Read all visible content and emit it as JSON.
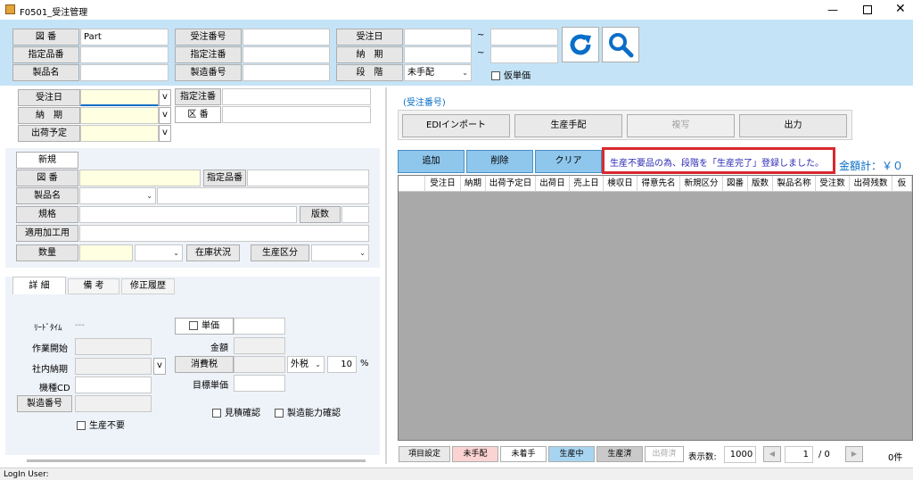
{
  "window": {
    "title": "F0501_受注管理"
  },
  "search": {
    "zuban_label": "図 番",
    "zuban_value": "Part",
    "shitei_hinban_label": "指定品番",
    "seihinmei_label": "製品名",
    "juchu_bango_label": "受注番号",
    "shitei_chuban_label": "指定注番",
    "seizo_bango_label": "製造番号",
    "juchubi_label": "受注日",
    "noki_label": "納　期",
    "dankai_label": "段　階",
    "dankai_value": "未手配",
    "tilde": "~",
    "karitanka_label": "仮単価"
  },
  "left": {
    "juchubi_label": "受注日",
    "noki_label": "納　期",
    "shukka_yotei_label": "出荷予定",
    "shitei_chuban_label": "指定注番",
    "kuban_label": "区 番",
    "v": "v",
    "shinki_label": "新規",
    "zuban_label": "図 番",
    "shitei_hinban_label": "指定品番",
    "seihinmei_label": "製品名",
    "kikaku_label": "規格",
    "hansu_label": "版数",
    "tekiyo_label": "適用加工用",
    "suryo_label": "数量",
    "zaiko_label": "在庫状況",
    "seisan_kubun_label": "生産区分",
    "tabs": [
      "詳 細",
      "備 考",
      "修正履歴"
    ],
    "leadtime_label": "ﾘｰﾄﾞﾀｲﾑ",
    "leadtime_value": "---",
    "sagyo_kaishi_label": "作業開始",
    "shanai_noki_label": "社内納期",
    "kishu_cd_label": "機種CD",
    "seizo_bango_btn": "製造番号",
    "seisan_fuyo_label": "生産不要",
    "tanka_label": "単価",
    "kingaku_label": "金額",
    "shohizei_label": "消費税",
    "zeikubun_value": "外税",
    "zeiritsu_value": "10",
    "percent": "%",
    "mokuhyo_tanka_label": "目標単価",
    "mitsumori_label": "見積確認",
    "seizo_noryoku_label": "製造能力確認"
  },
  "right": {
    "juchu_bango_caption": "(受注番号)",
    "edi_button": "EDIインポート",
    "seisan_tehai_button": "生産手配",
    "fukusha_button": "複写",
    "shutsuryoku_button": "出力",
    "tsuika_button": "追加",
    "sakujo_button": "削除",
    "clear_button": "クリア",
    "message": "生産不要品の為、段階を「生産完了」登録しました。",
    "total_label": "金額計：￥０",
    "columns": [
      "受注日",
      "納期",
      "出荷予定日",
      "出荷日",
      "売上日",
      "検収日",
      "得意先名",
      "新規区分",
      "図番",
      "版数",
      "製品名称",
      "受注数",
      "出荷残数",
      "仮"
    ],
    "koumoku_button": "項目設定",
    "status": [
      "未手配",
      "未着手",
      "生産中",
      "生産済",
      "出荷済"
    ],
    "hyoji_label": "表示数:",
    "hyoji_value": "1000",
    "page_value": "1",
    "page_total": "/ 0",
    "count": "0件"
  },
  "statusbar": {
    "login": "LogIn User:"
  },
  "colors": {
    "header_bg": "#c5e3f6",
    "accent": "#0a6ec8",
    "message_border": "#d8282e",
    "grid_bg": "#a9a9a9"
  }
}
